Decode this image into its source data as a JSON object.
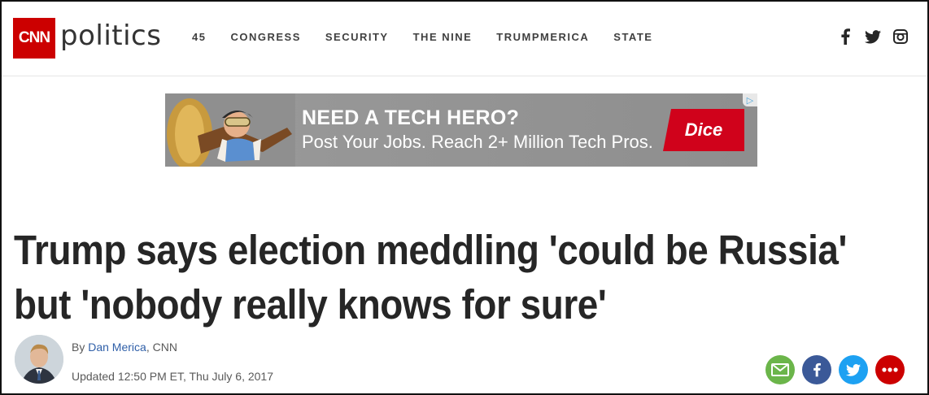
{
  "header": {
    "logo_text": "CNN",
    "section_word": "politics",
    "nav": [
      "45",
      "CONGRESS",
      "SECURITY",
      "THE NINE",
      "TRUMPMERICA",
      "STATE"
    ],
    "social": [
      "facebook-icon",
      "twitter-icon",
      "instagram-icon"
    ]
  },
  "ad": {
    "headline": "NEED A TECH HERO?",
    "subline": "Post Your Jobs. Reach 2+ Million Tech Pros.",
    "brand": "Dice",
    "choices_icon": "adchoices-icon"
  },
  "article": {
    "headline_line1": "Trump says election meddling 'could be Russia'",
    "headline_line2": "but 'nobody really knows for sure'",
    "byline_prefix": "By ",
    "author": "Dan Merica",
    "byline_suffix": ", CNN",
    "updated": "Updated 12:50 PM ET, Thu July 6, 2017"
  },
  "share": [
    "email-icon",
    "facebook-icon",
    "twitter-icon",
    "more-icon"
  ],
  "colors": {
    "brand_red": "#cc0000",
    "link_blue": "#2f5fa8",
    "email_green": "#6bb54a",
    "facebook_blue": "#3b5998",
    "twitter_blue": "#1da1f2"
  }
}
